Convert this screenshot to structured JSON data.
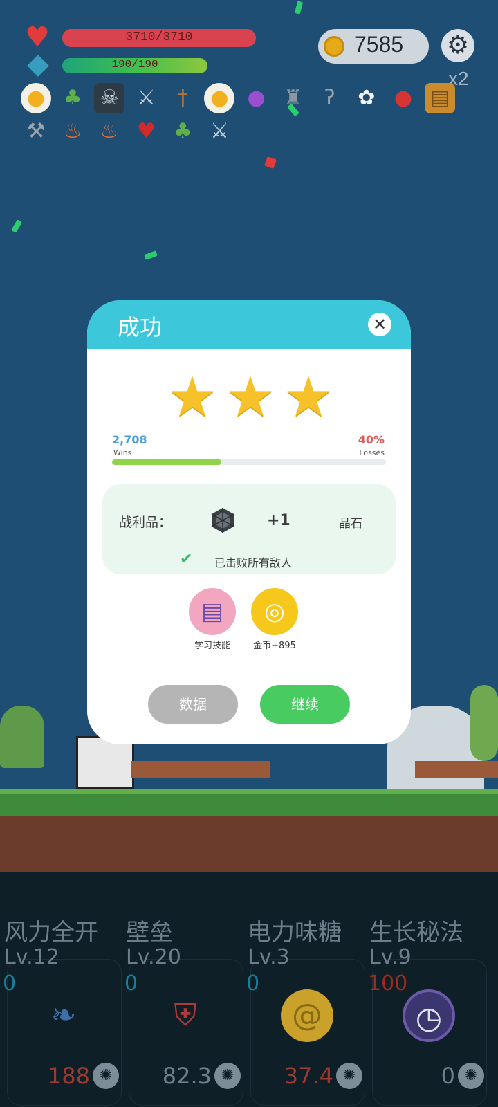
{
  "hud": {
    "hp_text": "3710/3710",
    "mp_text": "190/190",
    "coins": "7585",
    "multiplier": "x2",
    "items": [
      "fried-egg",
      "sapling",
      "skull-book",
      "sword",
      "dagger",
      "fried-egg",
      "crystal-ball",
      "viking-helmet",
      "hook",
      "flower",
      "apple",
      "spell-book",
      "axe",
      "torch",
      "torch",
      "cherries",
      "sapling",
      "sword"
    ]
  },
  "dialog": {
    "title": "成功",
    "stars": 3,
    "wins_value": "2,708",
    "wins_label": "Wins",
    "losses_value": "40%",
    "losses_label": "Losses",
    "progress": 0.4,
    "loot_label": "战利品：",
    "loot_count": "+1",
    "loot_name": "晶石",
    "defeat_text": "已击败所有敌人",
    "reward1_label": "学习技能",
    "reward2_label": "金币+895",
    "btn_data": "数据",
    "btn_continue": "继续"
  },
  "skills": [
    {
      "name": "风力全开",
      "level": "Lv.12",
      "value": "0",
      "cost": "188",
      "icon": "feather-icon"
    },
    {
      "name": "壁垒",
      "level": "Lv.20",
      "value": "0",
      "cost": "82.3",
      "icon": "armor-icon"
    },
    {
      "name": "电力味糖",
      "level": "Lv.3",
      "value": "0",
      "cost": "37.4",
      "icon": "lollipop-icon"
    },
    {
      "name": "生长秘法",
      "level": "Lv.9",
      "value": "100",
      "cost": "0",
      "icon": "clock-icon"
    }
  ],
  "colors": {
    "sky": "#1e4e73",
    "dialog_header": "#3cc7da",
    "continue_button": "#48cc62",
    "data_button": "#b5b5b5",
    "star": "#f7c12a"
  }
}
